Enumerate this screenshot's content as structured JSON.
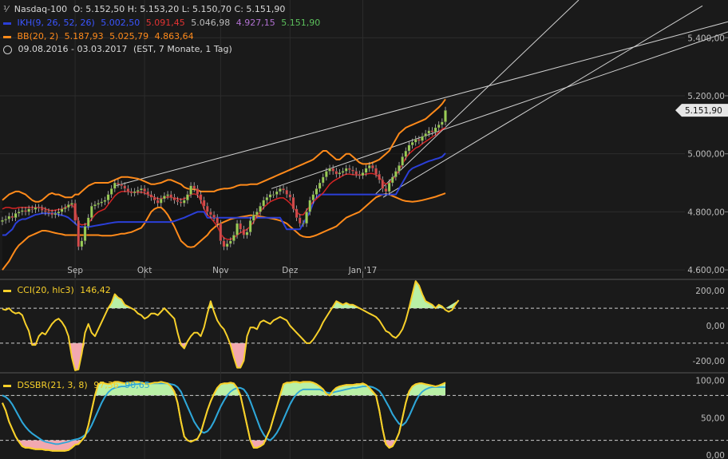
{
  "header": {
    "symbol": "Nasdaq-100",
    "ohlc": "O: 5.152,50  H: 5.153,20  L: 5.150,70  C: 5.151,90",
    "ikh_label": "IKH(9, 26, 52, 26)",
    "ikh_values": [
      "5.002,50",
      "5.091,45",
      "5.046,98",
      "4.927,15",
      "5.151,90"
    ],
    "bb_label": "BB(20, 2)",
    "bb_values": [
      "5.187,93",
      "5.025,79",
      "4.863,64"
    ],
    "range": "09.08.2016 - 03.03.2017",
    "range_info": "(EST, 7 Monate, 1 Tag)"
  },
  "colors": {
    "background": "#1a1a1a",
    "bullish": "#9acd55",
    "bearish": "#d64a4a",
    "bb": "#ff8a1a",
    "ikh_blue": "#2b3fd8",
    "ikh_red": "#d42424",
    "ikh_purple": "#9b59b6",
    "ikh_green": "#3cb043",
    "cci": "#f7d02a",
    "dss_signal": "#2ea6d8",
    "trend": "#d0d0d0",
    "fill_pos": "#b9f0a6",
    "fill_neg": "#f2a8b0"
  },
  "chart_data": [
    {
      "type": "candlestick",
      "title": "Nasdaq-100",
      "x_ticks": [
        "Sep",
        "Okt",
        "Nov",
        "Dez",
        "Jan '17"
      ],
      "y_ticks": [
        "5.400,00",
        "5.200,00",
        "5.000,00",
        "4.800,00",
        "4.600,00"
      ],
      "ylim": [
        4570,
        5530
      ],
      "last_price_label": "5.151,90",
      "closes": [
        4771,
        4775,
        4785,
        4780,
        4795,
        4800,
        4805,
        4800,
        4810,
        4808,
        4815,
        4812,
        4805,
        4800,
        4796,
        4790,
        4795,
        4800,
        4810,
        4815,
        4825,
        4830,
        4770,
        4680,
        4700,
        4750,
        4780,
        4820,
        4825,
        4830,
        4835,
        4840,
        4860,
        4880,
        4900,
        4895,
        4890,
        4880,
        4870,
        4865,
        4870,
        4875,
        4880,
        4870,
        4860,
        4850,
        4840,
        4830,
        4845,
        4855,
        4860,
        4850,
        4840,
        4835,
        4830,
        4840,
        4860,
        4890,
        4880,
        4860,
        4840,
        4820,
        4800,
        4790,
        4780,
        4760,
        4700,
        4680,
        4690,
        4700,
        4720,
        4760,
        4740,
        4720,
        4730,
        4770,
        4790,
        4800,
        4820,
        4840,
        4850,
        4860,
        4860,
        4870,
        4880,
        4875,
        4860,
        4850,
        4810,
        4780,
        4760,
        4760,
        4800,
        4840,
        4860,
        4880,
        4900,
        4920,
        4940,
        4950,
        4940,
        4930,
        4935,
        4940,
        4950,
        4945,
        4940,
        4930,
        4925,
        4935,
        4950,
        4960,
        4950,
        4930,
        4910,
        4880,
        4870,
        4900,
        4920,
        4940,
        4960,
        4990,
        5010,
        5030,
        5040,
        5050,
        5045,
        5060,
        5070,
        5080,
        5075,
        5090,
        5100,
        5110,
        5150
      ],
      "ikh_tenkan": [
        4810,
        4815,
        4815,
        4812,
        4812,
        4815,
        4815,
        4815,
        4815,
        4815,
        4815,
        4815,
        4815,
        4810,
        4806,
        4804,
        4806,
        4808,
        4810,
        4815,
        4820,
        4825,
        4810,
        4760,
        4755,
        4757,
        4760,
        4775,
        4790,
        4800,
        4805,
        4810,
        4825,
        4840,
        4855,
        4865,
        4870,
        4870,
        4870,
        4868,
        4868,
        4868,
        4868,
        4865,
        4860,
        4855,
        4850,
        4845,
        4845,
        4848,
        4852,
        4850,
        4848,
        4845,
        4843,
        4845,
        4850,
        4860,
        4862,
        4858,
        4840,
        4810,
        4790,
        4780,
        4765,
        4750,
        4725,
        4710,
        4705,
        4705,
        4710,
        4720,
        4728,
        4733,
        4740,
        4750,
        4765,
        4785,
        4800,
        4815,
        4825,
        4835,
        4840,
        4845,
        4848,
        4848,
        4840,
        4830,
        4815,
        4800,
        4790,
        4790,
        4805,
        4820,
        4835,
        4845,
        4855,
        4865,
        4880,
        4895,
        4905,
        4912,
        4918,
        4925,
        4930,
        4930,
        4928,
        4928,
        4926,
        4928,
        4930,
        4932,
        4932,
        4928,
        4920,
        4905,
        4895,
        4900,
        4910,
        4925,
        4945,
        4965,
        4985,
        5000,
        5010,
        5020,
        5025,
        5035,
        5042,
        5050,
        5058,
        5065,
        5075,
        5085,
        5091
      ],
      "ikh_kijun": [
        4720,
        4720,
        4730,
        4740,
        4760,
        4770,
        4775,
        4775,
        4780,
        4785,
        4790,
        4792,
        4795,
        4795,
        4795,
        4795,
        4795,
        4790,
        4788,
        4785,
        4780,
        4770,
        4760,
        4750,
        4748,
        4748,
        4748,
        4750,
        4752,
        4754,
        4756,
        4758,
        4760,
        4762,
        4764,
        4765,
        4765,
        4765,
        4765,
        4765,
        4765,
        4765,
        4765,
        4765,
        4765,
        4765,
        4765,
        4765,
        4765,
        4765,
        4765,
        4765,
        4768,
        4772,
        4776,
        4780,
        4785,
        4790,
        4795,
        4800,
        4800,
        4800,
        4780,
        4780,
        4780,
        4780,
        4780,
        4780,
        4780,
        4780,
        4780,
        4780,
        4780,
        4780,
        4780,
        4780,
        4780,
        4780,
        4780,
        4780,
        4780,
        4780,
        4780,
        4780,
        4780,
        4760,
        4740,
        4740,
        4740,
        4740,
        4740,
        4760,
        4780,
        4800,
        4830,
        4850,
        4860,
        4860,
        4860,
        4860,
        4860,
        4860,
        4860,
        4860,
        4860,
        4860,
        4860,
        4860,
        4860,
        4860,
        4860,
        4860,
        4860,
        4860,
        4860,
        4860,
        4860,
        4860,
        4860,
        4860,
        4880,
        4900,
        4920,
        4940,
        4950,
        4955,
        4960,
        4965,
        4970,
        4975,
        4978,
        4982,
        4985,
        4990,
        5002
      ],
      "bb_upper": [
        4840,
        4850,
        4860,
        4865,
        4870,
        4870,
        4865,
        4860,
        4850,
        4840,
        4835,
        4835,
        4840,
        4850,
        4860,
        4865,
        4860,
        4860,
        4855,
        4850,
        4850,
        4850,
        4860,
        4860,
        4870,
        4880,
        4890,
        4895,
        4900,
        4900,
        4900,
        4900,
        4900,
        4905,
        4910,
        4915,
        4920,
        4920,
        4920,
        4918,
        4916,
        4914,
        4910,
        4905,
        4900,
        4895,
        4895,
        4898,
        4900,
        4905,
        4910,
        4910,
        4905,
        4900,
        4895,
        4885,
        4880,
        4878,
        4878,
        4875,
        4870,
        4870,
        4870,
        4870,
        4870,
        4875,
        4878,
        4880,
        4880,
        4882,
        4885,
        4890,
        4893,
        4893,
        4893,
        4895,
        4895,
        4895,
        4900,
        4905,
        4910,
        4915,
        4920,
        4925,
        4930,
        4935,
        4940,
        4945,
        4950,
        4955,
        4960,
        4965,
        4970,
        4975,
        4980,
        4990,
        5000,
        5010,
        5010,
        5000,
        4990,
        4980,
        4980,
        4990,
        5000,
        5000,
        4990,
        4980,
        4970,
        4965,
        4965,
        4966,
        4970,
        4975,
        4980,
        4990,
        5000,
        5010,
        5030,
        5050,
        5070,
        5080,
        5090,
        5095,
        5100,
        5105,
        5110,
        5115,
        5120,
        5130,
        5140,
        5150,
        5160,
        5172,
        5188
      ],
      "bb_lower": [
        4600,
        4615,
        4630,
        4650,
        4670,
        4685,
        4695,
        4705,
        4715,
        4720,
        4725,
        4730,
        4735,
        4735,
        4733,
        4730,
        4727,
        4725,
        4723,
        4720,
        4720,
        4720,
        4720,
        4720,
        4720,
        4720,
        4720,
        4720,
        4720,
        4720,
        4718,
        4718,
        4718,
        4718,
        4720,
        4722,
        4725,
        4725,
        4728,
        4730,
        4735,
        4740,
        4745,
        4760,
        4780,
        4800,
        4810,
        4815,
        4815,
        4805,
        4790,
        4770,
        4750,
        4725,
        4700,
        4690,
        4680,
        4678,
        4680,
        4690,
        4700,
        4710,
        4720,
        4735,
        4745,
        4755,
        4760,
        4765,
        4770,
        4775,
        4778,
        4780,
        4782,
        4784,
        4786,
        4788,
        4788,
        4786,
        4784,
        4782,
        4780,
        4778,
        4776,
        4773,
        4770,
        4765,
        4760,
        4750,
        4740,
        4730,
        4720,
        4715,
        4713,
        4713,
        4716,
        4720,
        4725,
        4730,
        4735,
        4740,
        4745,
        4750,
        4760,
        4770,
        4780,
        4785,
        4790,
        4795,
        4800,
        4810,
        4820,
        4830,
        4840,
        4850,
        4855,
        4860,
        4862,
        4860,
        4855,
        4850,
        4845,
        4840,
        4837,
        4836,
        4835,
        4836,
        4838,
        4840,
        4843,
        4846,
        4849,
        4852,
        4856,
        4860,
        4864
      ],
      "trendlines": "3 drawn lines"
    },
    {
      "type": "line",
      "title": "CCI(20, hlc3)",
      "value_label": "146,42",
      "y_ticks": [
        "200,00",
        "0,00",
        "-200,00"
      ],
      "ylim": [
        -260,
        260
      ],
      "reference_lines": [
        100,
        -100
      ],
      "values": [
        95,
        90,
        100,
        80,
        70,
        75,
        60,
        10,
        -30,
        -110,
        -110,
        -60,
        -40,
        -50,
        -20,
        10,
        30,
        40,
        20,
        -10,
        -60,
        -180,
        -300,
        -250,
        -160,
        -40,
        10,
        -40,
        -60,
        -20,
        20,
        60,
        100,
        130,
        180,
        160,
        150,
        120,
        110,
        100,
        90,
        70,
        60,
        40,
        50,
        70,
        70,
        60,
        80,
        100,
        80,
        60,
        40,
        -40,
        -110,
        -130,
        -90,
        -60,
        -40,
        -40,
        -60,
        -10,
        70,
        140,
        80,
        30,
        0,
        -20,
        -60,
        -110,
        -180,
        -240,
        -240,
        -200,
        -60,
        -10,
        -10,
        -20,
        20,
        30,
        20,
        10,
        30,
        40,
        50,
        40,
        30,
        0,
        -20,
        -40,
        -60,
        -80,
        -100,
        -100,
        -80,
        -50,
        -20,
        20,
        50,
        80,
        110,
        140,
        130,
        120,
        130,
        120,
        120,
        110,
        100,
        90,
        80,
        70,
        60,
        50,
        30,
        0,
        -30,
        -40,
        -60,
        -70,
        -50,
        -20,
        30,
        100,
        180,
        260,
        230,
        180,
        140,
        130,
        120,
        100,
        120,
        110,
        90,
        80,
        90,
        120,
        146
      ],
      "fill_pos_label": "fill above 100",
      "fill_neg_label": "fill below -100"
    },
    {
      "type": "line",
      "title": "DSSBR(21, 3, 8)",
      "value_label": "97,36",
      "signal_label": "90,65",
      "y_ticks": [
        "100,00",
        "50,00",
        "0,00"
      ],
      "ylim": [
        -5,
        107
      ],
      "reference_lines": [
        80,
        20
      ],
      "series": [
        {
          "name": "DSSBR",
          "values": [
            70,
            60,
            45,
            35,
            25,
            18,
            12,
            10,
            10,
            9,
            8,
            8,
            8,
            7,
            7,
            6,
            6,
            6,
            6,
            6,
            7,
            10,
            14,
            15,
            20,
            25,
            40,
            60,
            80,
            95,
            97,
            96,
            95,
            96,
            98,
            98,
            97,
            96,
            97,
            97,
            98,
            98,
            97,
            96,
            95,
            96,
            97,
            97,
            98,
            97,
            96,
            92,
            85,
            70,
            45,
            25,
            20,
            18,
            20,
            22,
            30,
            45,
            60,
            72,
            82,
            90,
            95,
            96,
            96,
            97,
            96,
            90,
            80,
            60,
            40,
            20,
            10,
            10,
            12,
            15,
            25,
            35,
            50,
            65,
            80,
            95,
            97,
            97,
            98,
            98,
            97,
            98,
            98,
            98,
            97,
            95,
            92,
            88,
            82,
            80,
            86,
            90,
            92,
            93,
            94,
            94,
            94,
            95,
            95,
            96,
            94,
            90,
            85,
            80,
            60,
            35,
            15,
            10,
            12,
            20,
            30,
            50,
            70,
            85,
            92,
            95,
            96,
            96,
            95,
            94,
            93,
            92,
            93,
            95,
            97
          ]
        },
        {
          "name": "Signal",
          "values": [
            80,
            78,
            74,
            68,
            60,
            52,
            44,
            38,
            33,
            29,
            26,
            23,
            20,
            18,
            17,
            16,
            15,
            15,
            16,
            17,
            18,
            20,
            21,
            22,
            24,
            27,
            32,
            40,
            50,
            60,
            70,
            78,
            84,
            88,
            90,
            91,
            92,
            92,
            93,
            94,
            95,
            95,
            96,
            96,
            96,
            96,
            96,
            96,
            96,
            96,
            96,
            95,
            94,
            91,
            85,
            75,
            65,
            55,
            45,
            38,
            32,
            30,
            32,
            37,
            45,
            55,
            65,
            73,
            80,
            85,
            88,
            90,
            90,
            88,
            82,
            72,
            60,
            48,
            36,
            28,
            22,
            20,
            24,
            30,
            38,
            48,
            58,
            68,
            76,
            82,
            86,
            88,
            88,
            88,
            88,
            88,
            88,
            86,
            84,
            83,
            84,
            85,
            86,
            87,
            88,
            89,
            90,
            90,
            91,
            92,
            92,
            92,
            91,
            89,
            86,
            80,
            72,
            64,
            55,
            48,
            42,
            40,
            44,
            52,
            62,
            72,
            80,
            85,
            88,
            90,
            91,
            91,
            91,
            91,
            91
          ]
        }
      ],
      "fill_pos_label": "fill above 80",
      "fill_neg_label": "fill below 20"
    }
  ]
}
